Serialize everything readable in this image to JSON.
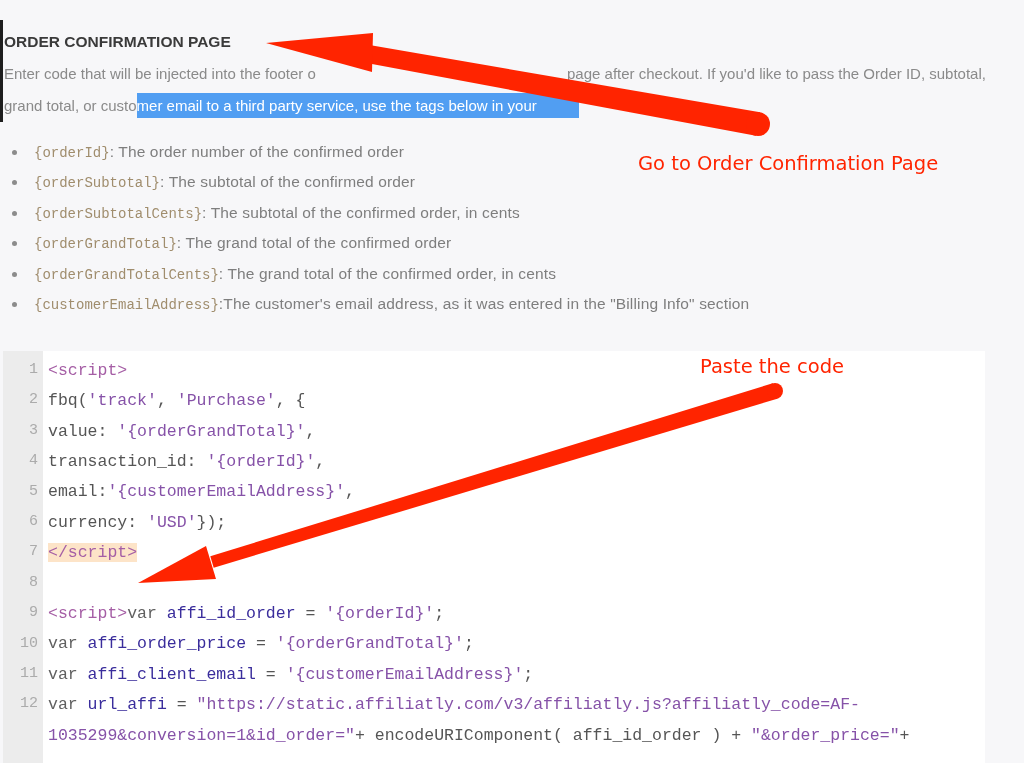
{
  "section": {
    "heading": "ORDER CONFIRMATION PAGE",
    "intro_lines": [
      {
        "segments": [
          {
            "text": "Enter code that will be injected into the footer o",
            "selected": false
          },
          {
            "text": "page after checkout. If you'd like to pass the Order ID, subtotal,",
            "selected": false
          }
        ]
      },
      {
        "segments": [
          {
            "text": "grand total, or custo",
            "selected": false
          },
          {
            "text": "mer email to a third party service, use the tags below in your",
            "selected": true
          }
        ]
      }
    ],
    "tags": [
      {
        "tag": "{orderId}",
        "description": ": The order number of the confirmed order"
      },
      {
        "tag": "{orderSubtotal}",
        "description": ": The subtotal of the confirmed order"
      },
      {
        "tag": "{orderSubtotalCents}",
        "description": ": The subtotal of the confirmed order, in cents"
      },
      {
        "tag": "{orderGrandTotal}",
        "description": ": The grand total of the confirmed order"
      },
      {
        "tag": "{orderGrandTotalCents}",
        "description": ": The grand total of the confirmed order, in cents"
      },
      {
        "tag": "{customerEmailAddress}",
        "description": ":The customer's email address, as it was entered in the \"Billing Info\" section"
      }
    ]
  },
  "code_editor": {
    "lines": [
      {
        "number": "1",
        "tokens": [
          {
            "kind": "tag",
            "text": "<script>"
          }
        ]
      },
      {
        "number": "2",
        "tokens": [
          {
            "kind": "plain",
            "text": "fbq("
          },
          {
            "kind": "string",
            "text": "'track'"
          },
          {
            "kind": "plain",
            "text": ", "
          },
          {
            "kind": "string",
            "text": "'Purchase'"
          },
          {
            "kind": "plain",
            "text": ", {"
          }
        ]
      },
      {
        "number": "3",
        "tokens": [
          {
            "kind": "plain",
            "text": "value: "
          },
          {
            "kind": "string",
            "text": "'{orderGrandTotal}'"
          },
          {
            "kind": "plain",
            "text": ","
          }
        ]
      },
      {
        "number": "4",
        "tokens": [
          {
            "kind": "plain",
            "text": "transaction_id: "
          },
          {
            "kind": "string",
            "text": "'{orderId}'"
          },
          {
            "kind": "plain",
            "text": ","
          }
        ]
      },
      {
        "number": "5",
        "tokens": [
          {
            "kind": "plain",
            "text": "email:"
          },
          {
            "kind": "string",
            "text": "'{customerEmailAddress}'"
          },
          {
            "kind": "plain",
            "text": ","
          }
        ]
      },
      {
        "number": "6",
        "tokens": [
          {
            "kind": "plain",
            "text": "currency: "
          },
          {
            "kind": "string",
            "text": "'USD'"
          },
          {
            "kind": "plain",
            "text": "});"
          }
        ]
      },
      {
        "number": "7",
        "tokens": [
          {
            "kind": "matched-tag",
            "text": "</script>"
          }
        ]
      },
      {
        "number": "8"
      },
      {
        "number": "9",
        "tokens": [
          {
            "kind": "tag",
            "text": "<script>"
          },
          {
            "kind": "keyword",
            "text": "var "
          },
          {
            "kind": "variable",
            "text": "affi_id_order"
          },
          {
            "kind": "plain",
            "text": " = "
          },
          {
            "kind": "string",
            "text": "'{orderId}'"
          },
          {
            "kind": "plain",
            "text": ";"
          }
        ]
      },
      {
        "number": "10",
        "tokens": [
          {
            "kind": "keyword",
            "text": "var "
          },
          {
            "kind": "variable",
            "text": "affi_order_price"
          },
          {
            "kind": "plain",
            "text": " = "
          },
          {
            "kind": "string",
            "text": "'{orderGrandTotal}'"
          },
          {
            "kind": "plain",
            "text": ";"
          }
        ]
      },
      {
        "number": "11",
        "tokens": [
          {
            "kind": "keyword",
            "text": "var "
          },
          {
            "kind": "variable",
            "text": "affi_client_email"
          },
          {
            "kind": "plain",
            "text": " = "
          },
          {
            "kind": "string",
            "text": "'{customerEmailAddress}'"
          },
          {
            "kind": "plain",
            "text": ";"
          }
        ]
      },
      {
        "number": "12",
        "tokens": [
          {
            "kind": "keyword",
            "text": "var "
          },
          {
            "kind": "variable",
            "text": "url_affi"
          },
          {
            "kind": "plain",
            "text": " = "
          },
          {
            "kind": "string",
            "text": "\"https://static.affiliatly.com/v3/affiliatly.js?affiliatly_code=AF-"
          }
        ],
        "wrap_tokens": [
          {
            "kind": "string",
            "text": "1035299&conversion=1&id_order=\""
          },
          {
            "kind": "plain",
            "text": "+ encodeURIComponent( affi_id_order ) + "
          },
          {
            "kind": "string",
            "text": "\"&order_price=\""
          },
          {
            "kind": "plain",
            "text": "+"
          }
        ]
      }
    ]
  },
  "annotations": [
    {
      "label": "Go to Order Confirmation Page"
    },
    {
      "label": "Paste the code"
    }
  ]
}
